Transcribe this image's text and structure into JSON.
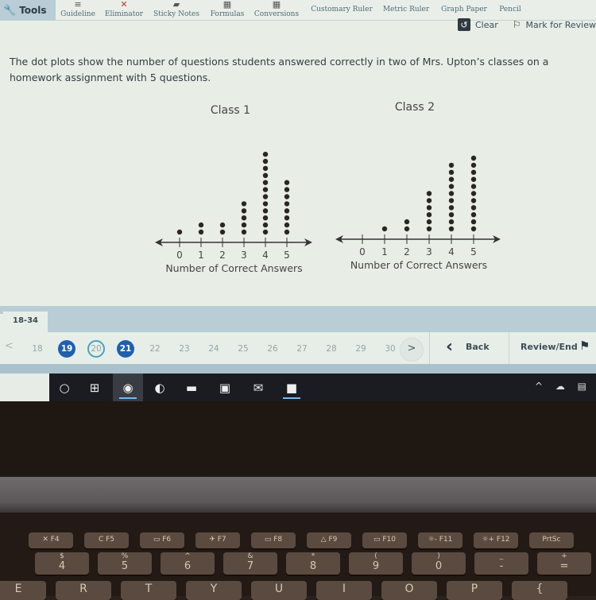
{
  "toolbar": {
    "tools_label": "Tools",
    "tools_icon": "wrench-icon",
    "items": [
      {
        "label": "Guideline",
        "icon": "guideline-icon",
        "glyph": "≡"
      },
      {
        "label": "Eliminator",
        "icon": "eliminator-icon",
        "glyph": "✕"
      },
      {
        "label": "Sticky Notes",
        "icon": "sticky-notes-icon",
        "glyph": "▰"
      },
      {
        "label": "Formulas",
        "icon": "formulas-icon",
        "glyph": "▦"
      },
      {
        "label": "Conversions",
        "icon": "conversions-icon",
        "glyph": "▦"
      },
      {
        "label": "Customary Ruler",
        "icon": "customary-ruler-icon",
        "glyph": ""
      },
      {
        "label": "Metric Ruler",
        "icon": "metric-ruler-icon",
        "glyph": ""
      },
      {
        "label": "Graph Paper",
        "icon": "graph-paper-icon",
        "glyph": ""
      },
      {
        "label": "Pencil",
        "icon": "pencil-icon",
        "glyph": ""
      }
    ],
    "clear_label": "Clear",
    "mark_label": "Mark for Review"
  },
  "question": {
    "prompt": "The dot plots show the number of questions students answered correctly in two of Mrs. Upton’s classes on a homework assignment with 5 questions."
  },
  "chart_data": [
    {
      "type": "scatter",
      "subtype": "dot-plot",
      "title": "Class 1",
      "xlabel": "Number of Correct Answers",
      "ylabel": "",
      "categories": [
        "0",
        "1",
        "2",
        "3",
        "4",
        "5"
      ],
      "values": [
        1,
        2,
        2,
        5,
        12,
        8
      ],
      "xlim": [
        0,
        5
      ],
      "grid": false
    },
    {
      "type": "scatter",
      "subtype": "dot-plot",
      "title": "Class 2",
      "xlabel": "Number of Correct Answers",
      "ylabel": "",
      "categories": [
        "0",
        "1",
        "2",
        "3",
        "4",
        "5"
      ],
      "values": [
        0,
        1,
        2,
        6,
        10,
        11
      ],
      "xlim": [
        0,
        5
      ],
      "grid": false
    }
  ],
  "navigation": {
    "range_label": "18-34",
    "questions": [
      {
        "num": "18",
        "state": "unanswered"
      },
      {
        "num": "19",
        "state": "answered"
      },
      {
        "num": "20",
        "state": "current"
      },
      {
        "num": "21",
        "state": "answered"
      },
      {
        "num": "22",
        "state": "unanswered"
      },
      {
        "num": "23",
        "state": "unanswered"
      },
      {
        "num": "24",
        "state": "unanswered"
      },
      {
        "num": "25",
        "state": "unanswered"
      },
      {
        "num": "26",
        "state": "unanswered"
      },
      {
        "num": "27",
        "state": "unanswered"
      },
      {
        "num": "28",
        "state": "unanswered"
      },
      {
        "num": "29",
        "state": "unanswered"
      },
      {
        "num": "30",
        "state": "unanswered"
      }
    ],
    "prev_glyph": "<",
    "next_glyph": ">",
    "back_label": "Back",
    "review_label": "Review/End",
    "answered_color": "#1f5fb0",
    "current_ring_color": "#47a3c2"
  },
  "taskbar": {
    "items": [
      {
        "name": "search-icon",
        "glyph": "○"
      },
      {
        "name": "task-view-icon",
        "glyph": "⊞"
      },
      {
        "name": "chrome-icon",
        "glyph": "◉"
      },
      {
        "name": "edge-icon",
        "glyph": "◐"
      },
      {
        "name": "file-explorer-icon",
        "glyph": "▬"
      },
      {
        "name": "store-icon",
        "glyph": "▣"
      },
      {
        "name": "mail-icon",
        "glyph": "✉"
      },
      {
        "name": "zoom-icon",
        "glyph": "■"
      }
    ],
    "tray": "^ ☁ ▤"
  },
  "keyboard": {
    "fkeys": [
      "✕ F4",
      "C F5",
      "▭ F6",
      "✈ F7",
      "▭ F8",
      "△ F9",
      "▭ F10",
      "☼- F11",
      "☼+ F12",
      "PrtSc"
    ],
    "numkeys": [
      {
        "top": "$",
        "main": "4"
      },
      {
        "top": "%",
        "main": "5"
      },
      {
        "top": "^",
        "main": "6"
      },
      {
        "top": "&",
        "main": "7"
      },
      {
        "top": "*",
        "main": "8"
      },
      {
        "top": "(",
        "main": "9"
      },
      {
        "top": ")",
        "main": "0"
      },
      {
        "top": "_",
        "main": "-"
      },
      {
        "top": "+",
        "main": "="
      }
    ],
    "letters": [
      "E",
      "R",
      "T",
      "Y",
      "U",
      "I",
      "O",
      "P",
      "{"
    ]
  }
}
